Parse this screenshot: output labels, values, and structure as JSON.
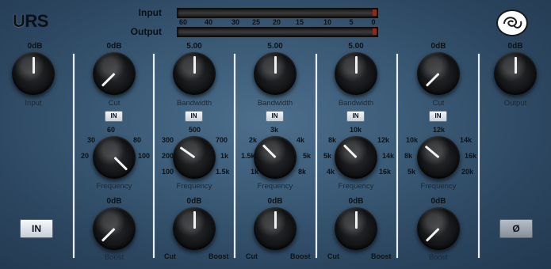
{
  "app": {
    "logo_letter": "U",
    "logo_rest": "RS",
    "brand_icon": "logo-swirl-icon"
  },
  "meters": {
    "input_label": "Input",
    "output_label": "Output",
    "scale": [
      "60",
      "40",
      "30",
      "25",
      "20",
      "15",
      "10",
      "5",
      "0"
    ]
  },
  "input_knob": {
    "value": "0dB",
    "label": "Input"
  },
  "output_knob": {
    "value": "0dB",
    "label": "Output"
  },
  "in_button": "IN",
  "phase_button": "Ø",
  "bands": [
    {
      "top_value": "0dB",
      "top_label": "Cut",
      "in": "IN",
      "freq_scale": {
        "top": "60",
        "ul": "30",
        "ur": "80",
        "l": "20",
        "r": "100"
      },
      "freq_label": "Frequency",
      "bottom_value": "0dB",
      "bottom_label": "Boost",
      "bottom_left": "",
      "bottom_right": ""
    },
    {
      "top_value": "5.00",
      "top_label": "Bandwidth",
      "in": "IN",
      "freq_scale": {
        "top": "500",
        "ul": "300",
        "ur": "700",
        "l": "200",
        "r": "1k",
        "ll": "100",
        "lr": "1.5k"
      },
      "freq_label": "Frequency",
      "bottom_value": "0dB",
      "bottom_label": "",
      "bottom_left": "Cut",
      "bottom_right": "Boost"
    },
    {
      "top_value": "5.00",
      "top_label": "Bandwidth",
      "in": "IN",
      "freq_scale": {
        "top": "3k",
        "ul": "2k",
        "ur": "4k",
        "l": "1.5k",
        "r": "5k",
        "ll": "1k",
        "lr": "8k"
      },
      "freq_label": "Frequency",
      "bottom_value": "0dB",
      "bottom_label": "",
      "bottom_left": "Cut",
      "bottom_right": "Boost"
    },
    {
      "top_value": "5.00",
      "top_label": "Bandwidth",
      "in": "IN",
      "freq_scale": {
        "top": "10k",
        "ul": "8k",
        "ur": "12k",
        "l": "5k",
        "r": "14k",
        "ll": "4k",
        "lr": "16k"
      },
      "freq_label": "Frequency",
      "bottom_value": "0dB",
      "bottom_label": "",
      "bottom_left": "Cut",
      "bottom_right": "Boost"
    },
    {
      "top_value": "0dB",
      "top_label": "Cut",
      "in": "IN",
      "freq_scale": {
        "top": "12k",
        "ul": "10k",
        "ur": "14k",
        "l": "8k",
        "r": "16k",
        "ll": "5k",
        "lr": "20k"
      },
      "freq_label": "Frequency",
      "bottom_value": "0dB",
      "bottom_label": "Boost",
      "bottom_left": "",
      "bottom_right": ""
    }
  ]
}
